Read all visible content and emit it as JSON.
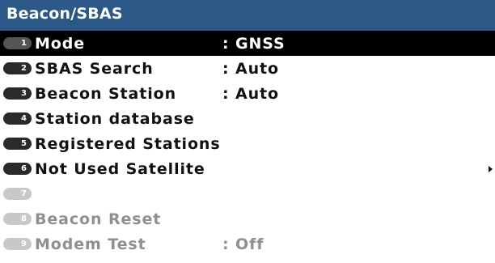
{
  "window": {
    "title": "Beacon/SBAS"
  },
  "menu": {
    "items": [
      {
        "number": "1",
        "label": "Mode",
        "value": ": GNSS",
        "state": "selected"
      },
      {
        "number": "2",
        "label": "SBAS Search",
        "value": ": Auto",
        "state": "enabled"
      },
      {
        "number": "3",
        "label": "Beacon Station",
        "value": ": Auto",
        "state": "enabled"
      },
      {
        "number": "4",
        "label": "Station database",
        "value": "",
        "state": "enabled"
      },
      {
        "number": "5",
        "label": "Registered Stations",
        "value": "",
        "state": "enabled"
      },
      {
        "number": "6",
        "label": "Not Used Satellite",
        "value": "",
        "state": "enabled",
        "submenu_icon": "right-triangle-icon"
      },
      {
        "number": "7",
        "label": "",
        "value": "",
        "state": "disabled"
      },
      {
        "number": "8",
        "label": "Beacon Reset",
        "value": "",
        "state": "disabled"
      },
      {
        "number": "9",
        "label": "Modem Test",
        "value": ": Off",
        "state": "disabled"
      }
    ]
  },
  "colors": {
    "title_bar": "#2b5887",
    "selected_row": "#000000",
    "disabled_text": "#8f8f8f"
  }
}
